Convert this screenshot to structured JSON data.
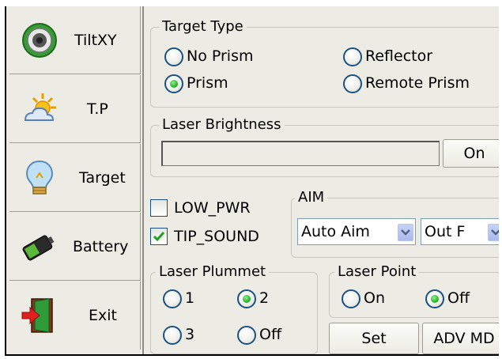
{
  "sidebar": {
    "items": [
      {
        "label": "TiltXY"
      },
      {
        "label": "T.P"
      },
      {
        "label": "Target"
      },
      {
        "label": "Battery"
      },
      {
        "label": "Exit"
      }
    ]
  },
  "target_type": {
    "legend": "Target Type",
    "options": [
      {
        "label": "No Prism",
        "selected": false
      },
      {
        "label": "Reflector",
        "selected": false
      },
      {
        "label": "Prism",
        "selected": true
      },
      {
        "label": "Remote Prism",
        "selected": false
      }
    ]
  },
  "laser_brightness": {
    "legend": "Laser Brightness",
    "button": "On"
  },
  "checkboxes": [
    {
      "label": "LOW_PWR",
      "checked": false
    },
    {
      "label": "TIP_SOUND",
      "checked": true
    }
  ],
  "aim": {
    "legend": "AIM",
    "combo1": "Auto Aim",
    "combo2": "Out F"
  },
  "laser_plummet": {
    "legend": "Laser Plummet",
    "options": [
      {
        "label": "1",
        "selected": false
      },
      {
        "label": "2",
        "selected": true
      },
      {
        "label": "3",
        "selected": false
      },
      {
        "label": "Off",
        "selected": false
      }
    ]
  },
  "laser_point": {
    "legend": "Laser Point",
    "options": [
      {
        "label": "On",
        "selected": false
      },
      {
        "label": "Off",
        "selected": true
      }
    ]
  },
  "buttons": {
    "set": "Set",
    "adv": "ADV MD"
  }
}
